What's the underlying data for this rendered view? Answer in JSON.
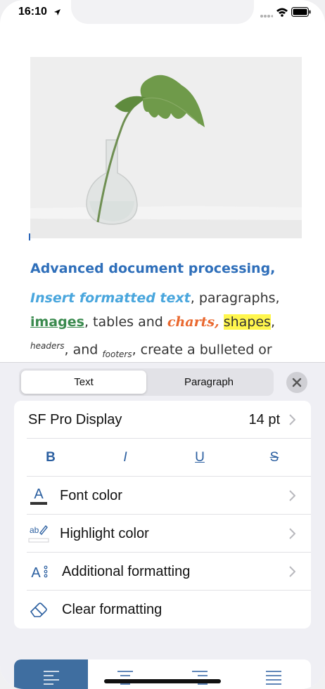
{
  "status": {
    "time": "16:10"
  },
  "document": {
    "heading": "Advanced document processing,",
    "runs": {
      "insert": "Insert formatted text",
      "t1": ",  paragraphs, ",
      "images": "images",
      "t2": ", tables and ",
      "charts": "charts,",
      "t3": " ",
      "shapes": "shapes",
      "t4": ", ",
      "headers": "headers",
      "t5": ", and ",
      "footers": "footers",
      "t6": ", create a bulleted or numbered"
    }
  },
  "panel": {
    "tabs": {
      "text": "Text",
      "paragraph": "Paragraph"
    },
    "font": {
      "name": "SF Pro Display",
      "size": "14 pt"
    },
    "styles": {
      "bold": "B",
      "italic": "I",
      "underline": "U",
      "strike": "S"
    },
    "items": {
      "font_color": "Font color",
      "highlight_color": "Highlight color",
      "additional": "Additional formatting",
      "clear": "Clear formatting"
    },
    "icons": {
      "font_color_glyph": "A",
      "highlight_glyph": "ab",
      "additional_glyph": "A"
    }
  },
  "colors": {
    "accent": "#2b5fa0",
    "heading": "#2f6fba",
    "insert": "#49a6dd",
    "images": "#3a8a4e",
    "charts": "#e9682f",
    "highlight": "#fff64d",
    "align_active": "#3f6ea0"
  }
}
